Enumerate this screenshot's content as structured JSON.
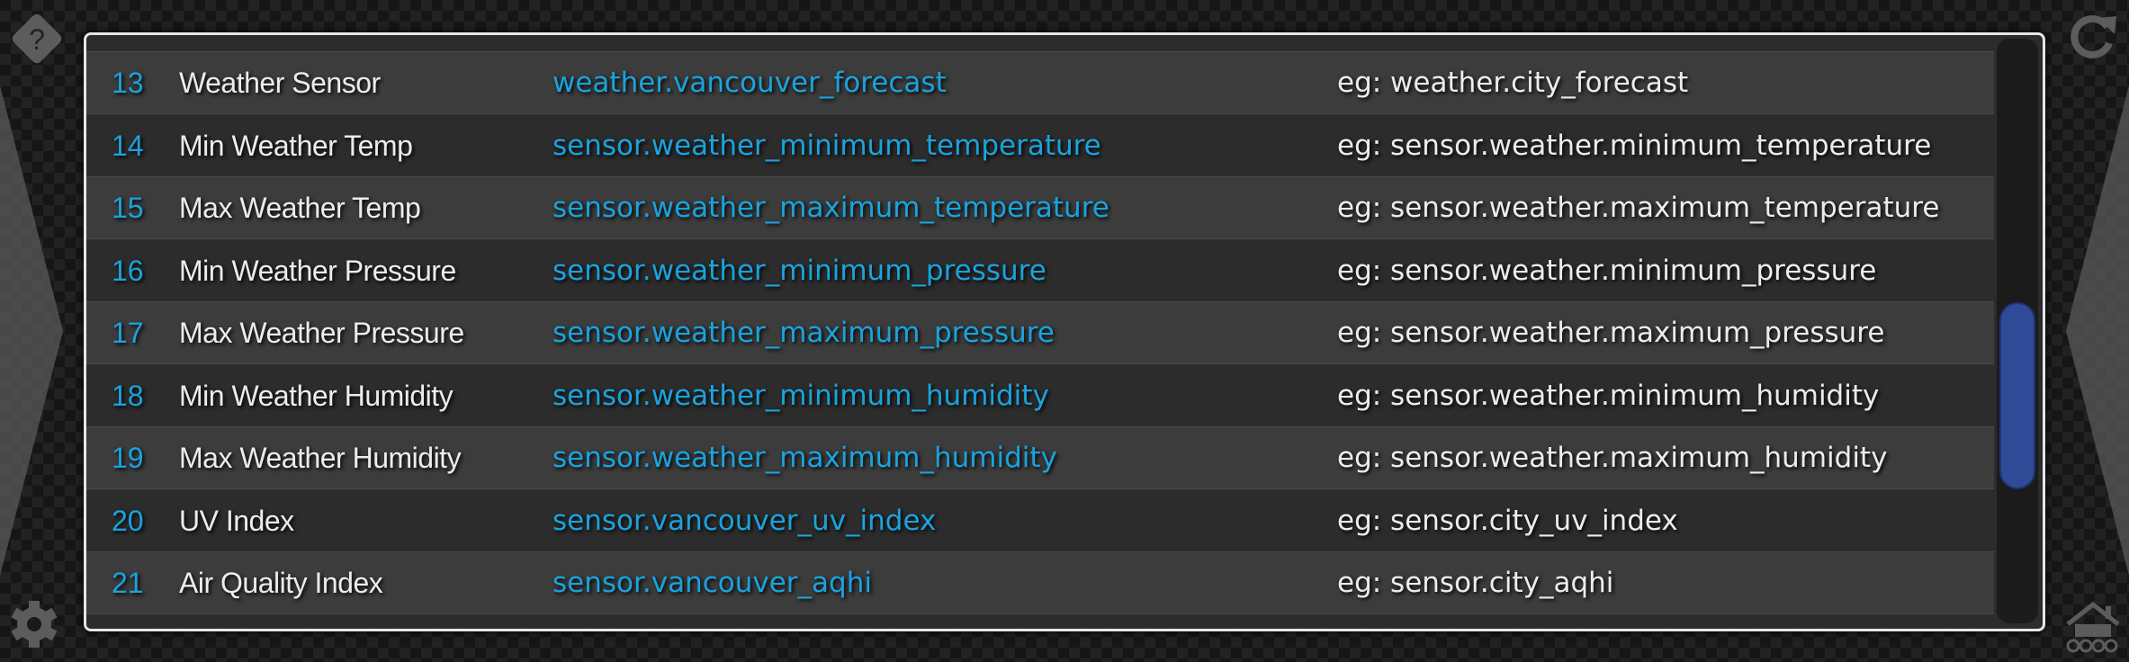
{
  "colors": {
    "accent": "#1aa3dd",
    "text": "#ececec",
    "scrollbar_thumb": "#2f4b98",
    "panel_border": "#e6e6e6"
  },
  "icons": {
    "top_left": "help-icon",
    "top_right": "refresh-icon",
    "bottom_left": "gear-icon",
    "bottom_right": "home-icon"
  },
  "table": {
    "rows": [
      {
        "num": "13",
        "name": "Weather Sensor",
        "entity": "weather.vancouver_forecast",
        "example": "eg: weather.city_forecast"
      },
      {
        "num": "14",
        "name": "Min Weather Temp",
        "entity": "sensor.weather_minimum_temperature",
        "example": "eg: sensor.weather.minimum_temperature"
      },
      {
        "num": "15",
        "name": "Max Weather Temp",
        "entity": "sensor.weather_maximum_temperature",
        "example": "eg: sensor.weather.maximum_temperature"
      },
      {
        "num": "16",
        "name": "Min Weather Pressure",
        "entity": "sensor.weather_minimum_pressure",
        "example": "eg: sensor.weather.minimum_pressure"
      },
      {
        "num": "17",
        "name": "Max Weather Pressure",
        "entity": "sensor.weather_maximum_pressure",
        "example": "eg: sensor.weather.maximum_pressure"
      },
      {
        "num": "18",
        "name": "Min Weather Humidity",
        "entity": "sensor.weather_minimum_humidity",
        "example": "eg: sensor.weather.minimum_humidity"
      },
      {
        "num": "19",
        "name": "Max Weather Humidity",
        "entity": "sensor.weather_maximum_humidity",
        "example": "eg: sensor.weather.maximum_humidity"
      },
      {
        "num": "20",
        "name": "UV Index",
        "entity": "sensor.vancouver_uv_index",
        "example": "eg: sensor.city_uv_index"
      },
      {
        "num": "21",
        "name": "Air Quality Index",
        "entity": "sensor.vancouver_aqhi",
        "example": "eg: sensor.city_aqhi"
      }
    ]
  },
  "scrollbar": {
    "position_fraction": 0.45,
    "visible_fraction": 0.32
  }
}
